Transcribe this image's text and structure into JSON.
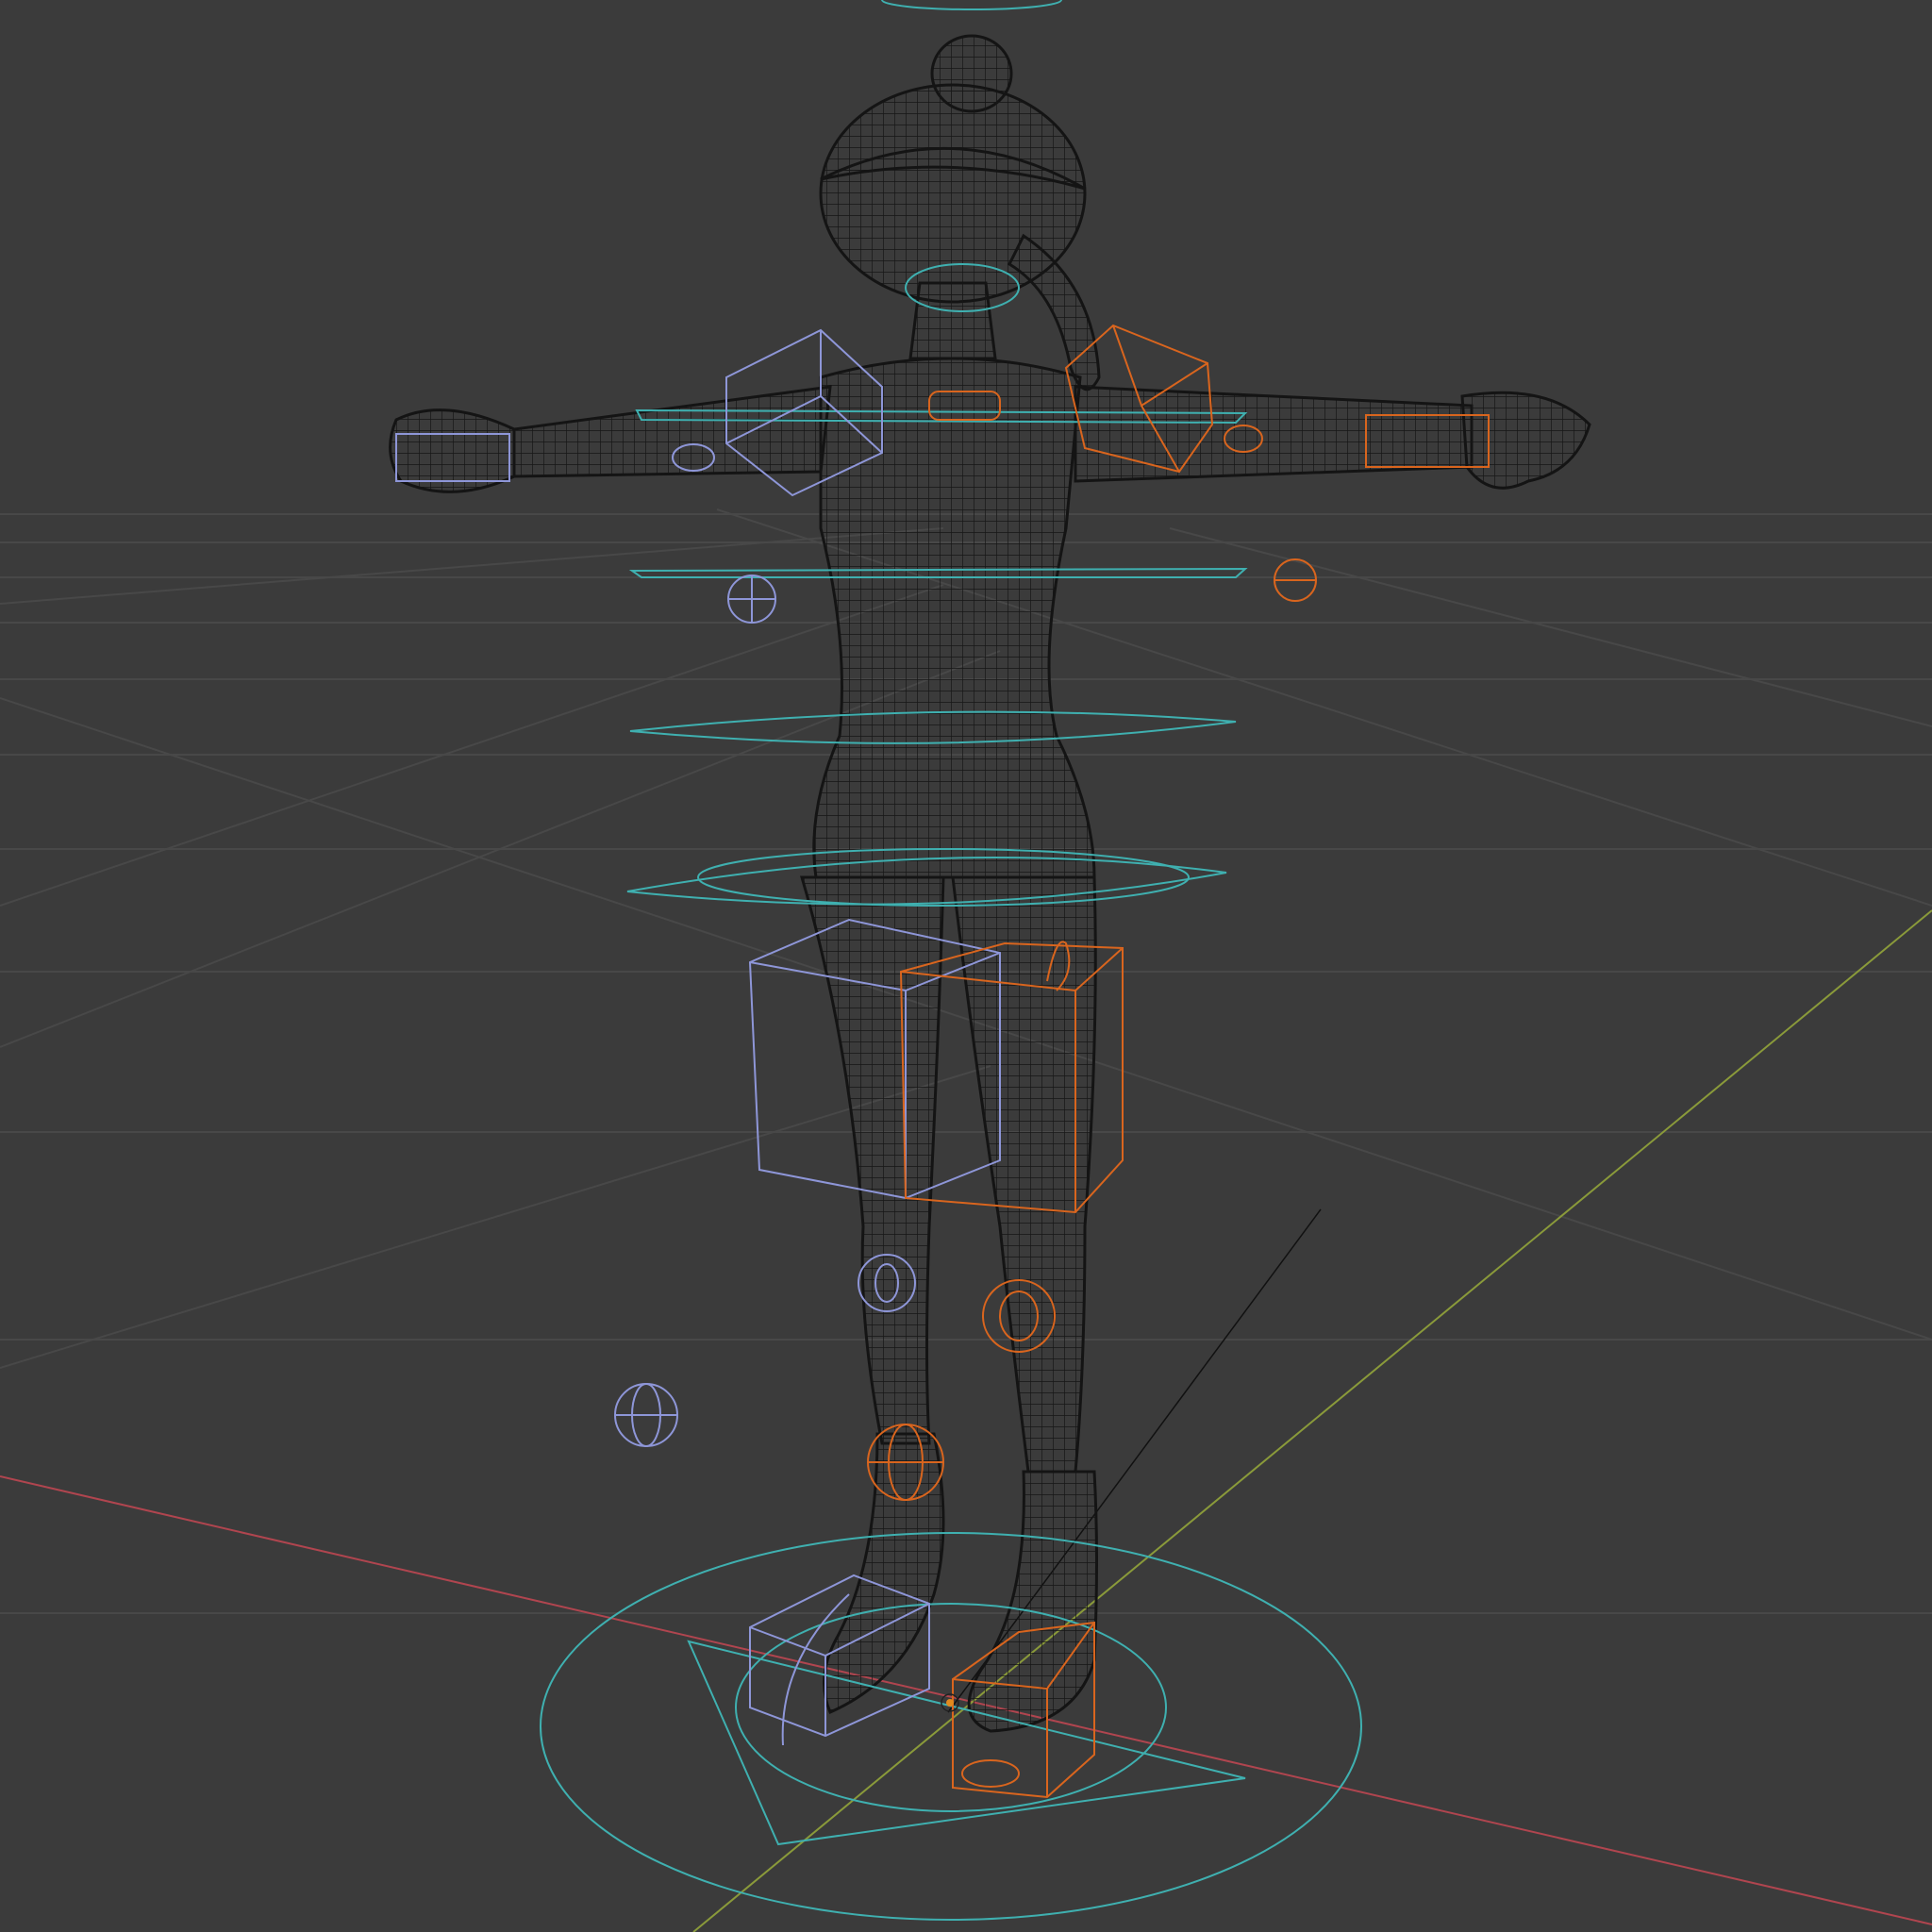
{
  "viewport": {
    "view_mode": "wireframe",
    "background": "#3b3b3b",
    "grid_color": "#4a4a4a",
    "x_axis_color": "#b0454f",
    "y_axis_color": "#8a9a3a",
    "mesh_color": "#151515",
    "rig_colors": {
      "left_side": "#8e96d8",
      "right_side": "#d9651e",
      "center": "#3fb0b0"
    },
    "objects": [
      {
        "id": "character-mesh",
        "icon": "mesh-icon"
      },
      {
        "id": "armature-rig",
        "icon": "armature-icon"
      },
      {
        "id": "camera-line",
        "icon": "camera-icon"
      }
    ]
  }
}
